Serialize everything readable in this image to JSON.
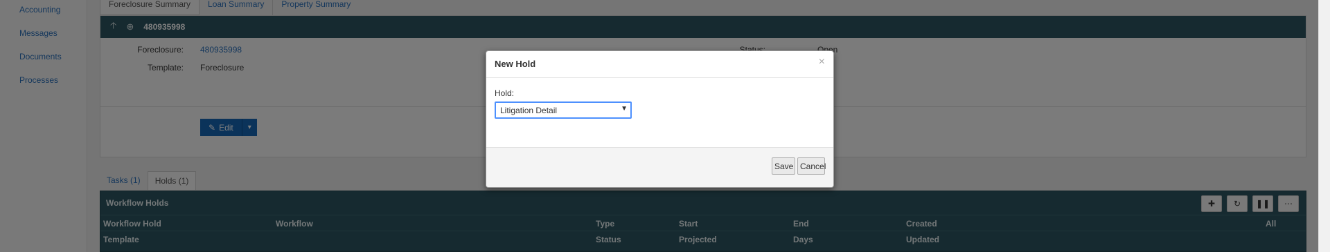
{
  "nav": {
    "items": [
      {
        "label": "Accounting"
      },
      {
        "label": "Messages"
      },
      {
        "label": "Documents"
      },
      {
        "label": "Processes"
      }
    ]
  },
  "top_tabs": [
    {
      "label": "Foreclosure Summary"
    },
    {
      "label": "Loan Summary"
    },
    {
      "label": "Property Summary"
    }
  ],
  "detail": {
    "header_title": "480935998",
    "foreclosure_label": "Foreclosure:",
    "foreclosure_value": "480935998",
    "template_label": "Template:",
    "template_value": "Foreclosure",
    "status_label": "Status:",
    "status_value": "Open",
    "edit_label": "Edit"
  },
  "bottom_tabs": [
    {
      "label": "Tasks (1)"
    },
    {
      "label": "Holds (1)"
    }
  ],
  "holds": {
    "title": "Workflow Holds",
    "columns_row1": [
      "Workflow Hold",
      "Workflow",
      "Type",
      "Start",
      "End",
      "Created",
      "All"
    ],
    "columns_row2": [
      "Template",
      "Status",
      "Projected",
      "Days",
      "Updated"
    ]
  },
  "modal": {
    "title": "New Hold",
    "close": "×",
    "hold_label": "Hold:",
    "hold_value": "Litigation Detail",
    "save_label": "Save",
    "cancel_label": "Cancel"
  },
  "colors": {
    "panel_header": "#2d5561",
    "link": "#2a6fb8",
    "primary_button": "#1766b5",
    "focus_outline": "#4d90fe"
  }
}
